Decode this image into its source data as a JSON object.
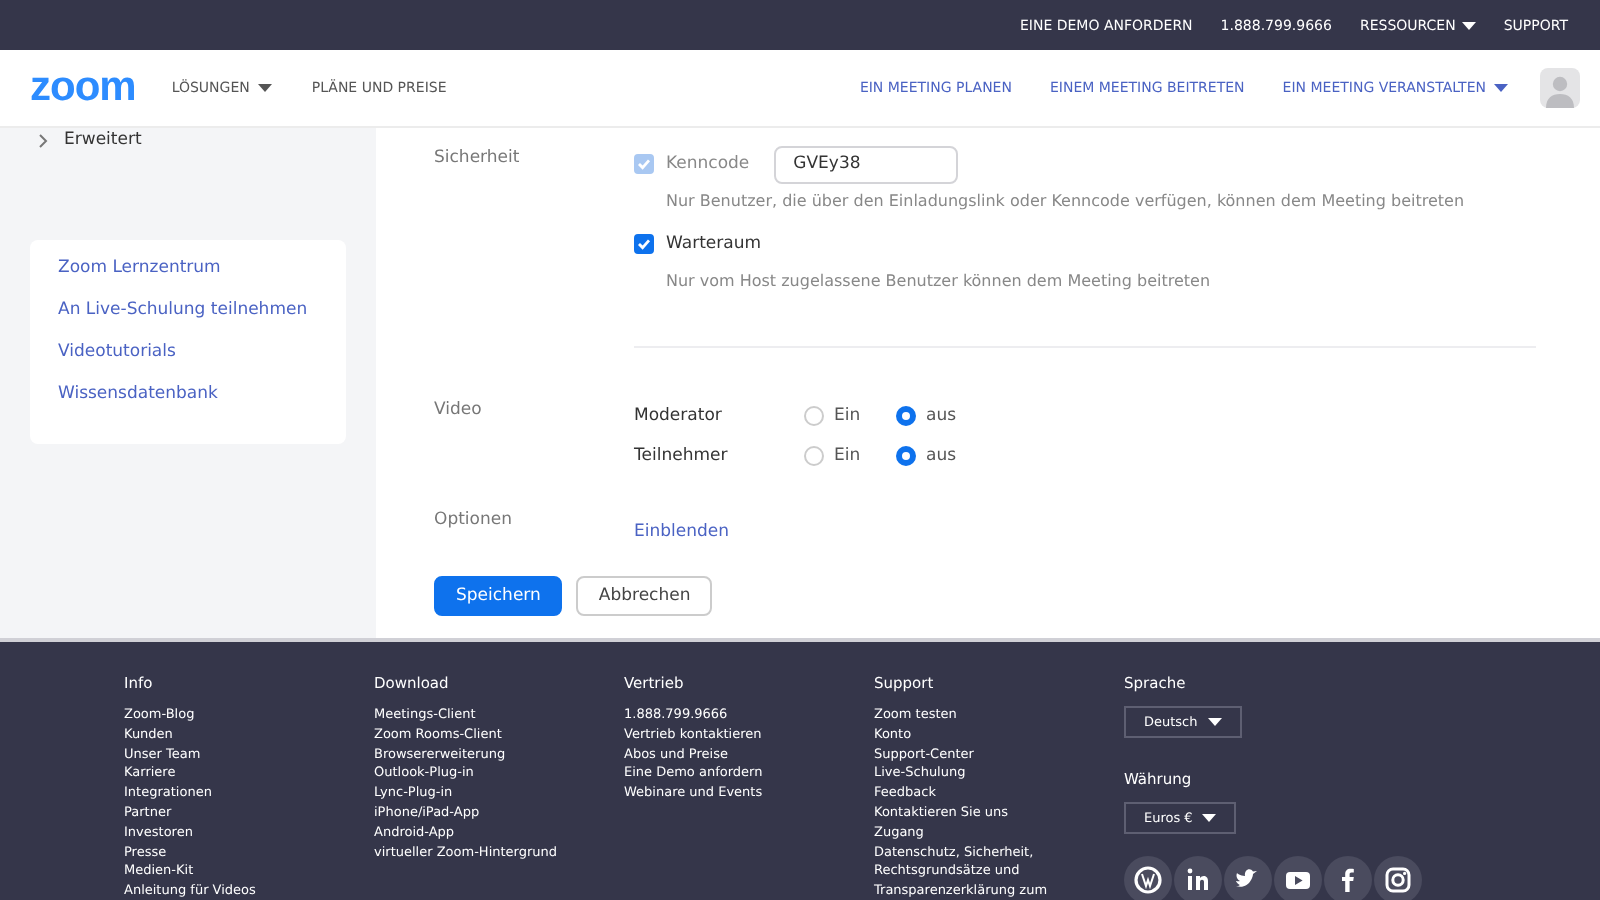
{
  "top_bar": {
    "links": [
      {
        "label": "EINE DEMO ANFORDERN",
        "dropdown": false
      },
      {
        "label": "1.888.799.9666",
        "dropdown": false
      },
      {
        "label": "RESSOURCEN",
        "dropdown": true
      },
      {
        "label": "SUPPORT",
        "dropdown": false
      }
    ]
  },
  "nav": {
    "logo": "zoom",
    "left_links": [
      {
        "label": "LÖSUNGEN",
        "dropdown": true
      },
      {
        "label": "PLÄNE UND PREISE",
        "dropdown": false
      }
    ],
    "right_links": [
      {
        "label": "EIN MEETING PLANEN",
        "dropdown": false
      },
      {
        "label": "EINEM MEETING BEITRETEN",
        "dropdown": false
      },
      {
        "label": "EIN MEETING VERANSTALTEN",
        "dropdown": true
      }
    ]
  },
  "sidebar": {
    "expander": {
      "label": "Erweitert",
      "expanded": false
    },
    "help_links": [
      "Zoom Lernzentrum",
      "An Live-Schulung teilnehmen",
      "Videotutorials",
      "Wissensdatenbank"
    ]
  },
  "security": {
    "label": "Sicherheit",
    "options": [
      {
        "label": "Kenncode",
        "checked": true,
        "disabled": true,
        "value": "GVEy38",
        "description": "Nur Benutzer, die über den Einladungslink oder Kenncode verfügen, können dem Meeting beitreten"
      },
      {
        "label": "Warteraum",
        "checked": true,
        "disabled": false,
        "description": "Nur vom Host zugelassene Benutzer können dem Meeting beitreten"
      }
    ]
  },
  "video": {
    "label": "Video",
    "rows": [
      {
        "label": "Moderator",
        "choices": [
          {
            "label": "Ein",
            "selected": false
          },
          {
            "label": "aus",
            "selected": true
          }
        ]
      },
      {
        "label": "Teilnehmer",
        "choices": [
          {
            "label": "Ein",
            "selected": false
          },
          {
            "label": "aus",
            "selected": true
          }
        ]
      }
    ]
  },
  "options": {
    "label": "Optionen",
    "link": "Einblenden"
  },
  "buttons": [
    {
      "label": "Speichern",
      "kind": "primary"
    },
    {
      "label": "Abbrechen",
      "kind": "secondary"
    }
  ],
  "footer": {
    "columns": [
      {
        "title": "Info",
        "links": [
          "Zoom-Blog",
          "Kunden",
          "Unser Team",
          "Karriere",
          "Integrationen",
          "Partner",
          "Investoren",
          "Presse",
          "Medien-Kit",
          "Anleitung für Videos"
        ]
      },
      {
        "title": "Download",
        "links": [
          "Meetings-Client",
          "Zoom Rooms-Client",
          "Browsererweiterung",
          "Outlook-Plug-in",
          "Lync-Plug-in",
          "iPhone/iPad-App",
          "Android-App",
          "virtueller Zoom-Hintergrund"
        ]
      },
      {
        "title": "Vertrieb",
        "links": [
          "1.888.799.9666",
          "Vertrieb kontaktieren",
          "Abos und Preise",
          "Eine Demo anfordern",
          "Webinare und Events"
        ]
      },
      {
        "title": "Support",
        "links": [
          "Zoom testen",
          "Konto",
          "Support-Center",
          "Live-Schulung",
          "Feedback",
          "Kontaktieren Sie uns",
          "Zugang",
          "Datenschutz, Sicherheit,",
          "Rechtsgrundsätze und",
          "Transparenzerklärung zum"
        ]
      }
    ],
    "language": {
      "title": "Sprache",
      "value": "Deutsch"
    },
    "currency": {
      "title": "Währung",
      "value": "Euros €"
    }
  }
}
